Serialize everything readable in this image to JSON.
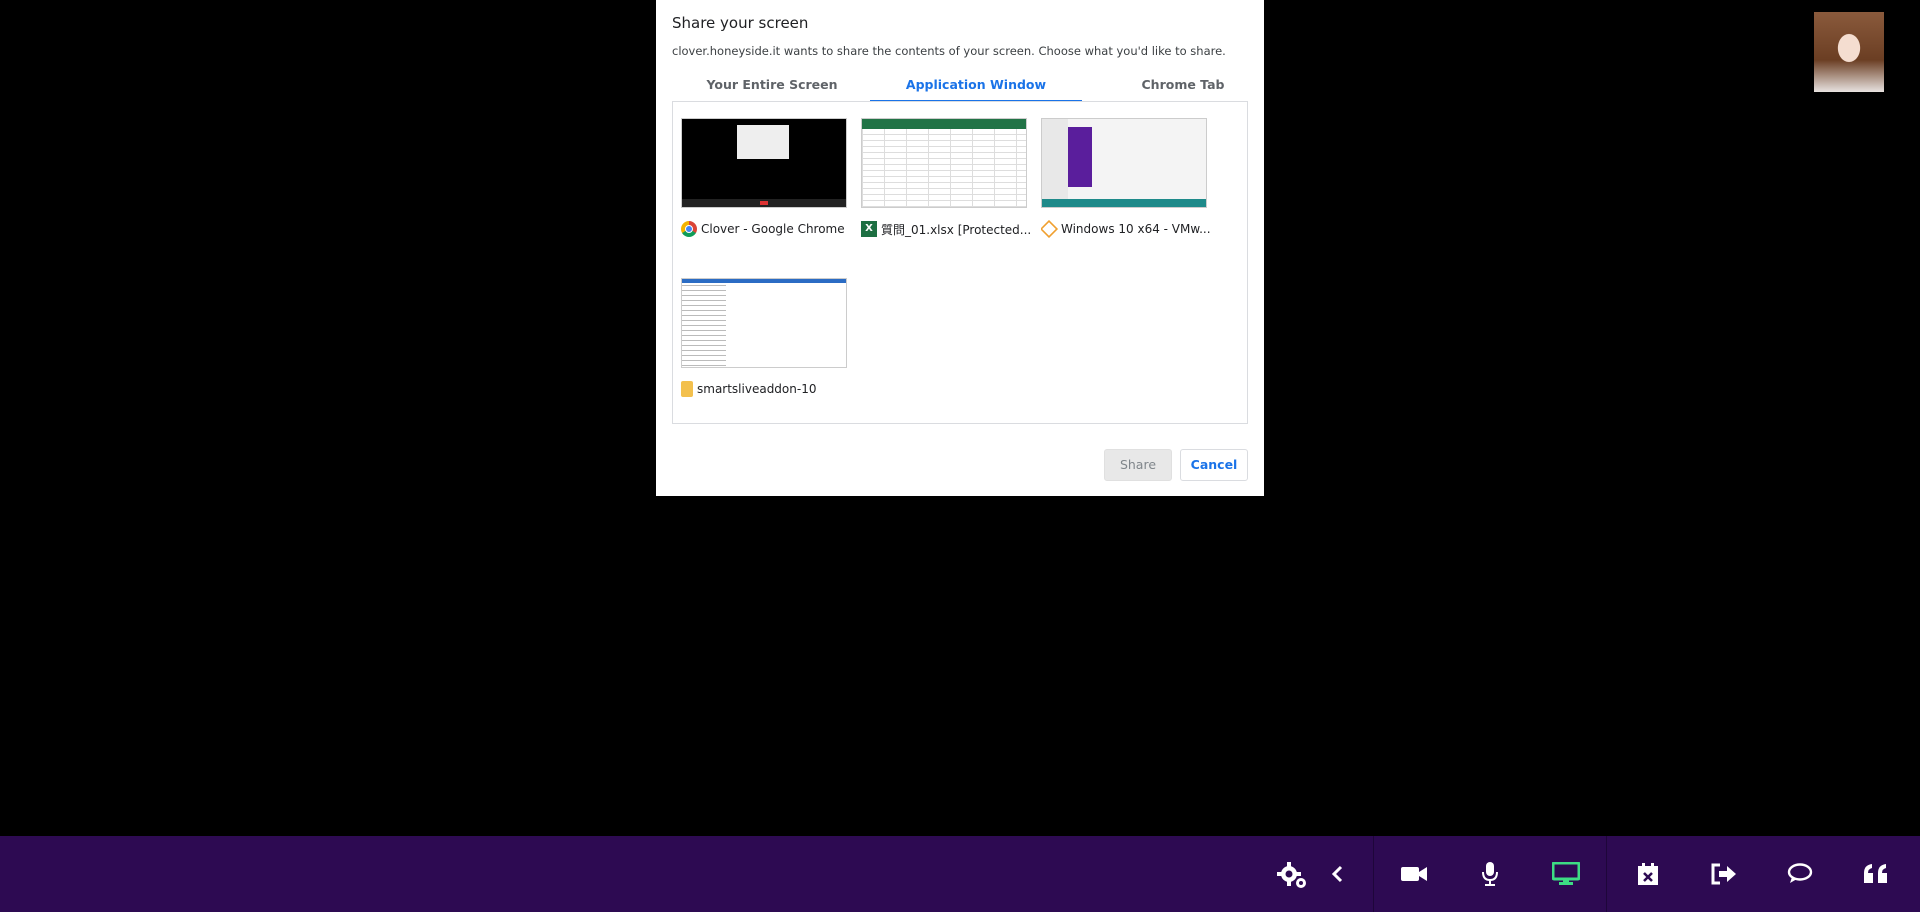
{
  "dialog": {
    "title": "Share your screen",
    "subtitle": "clover.honeyside.it wants to share the contents of your screen. Choose what you'd like to share.",
    "tabs": [
      {
        "label": "Your Entire Screen",
        "active": false
      },
      {
        "label": "Application Window",
        "active": true
      },
      {
        "label": "Chrome Tab",
        "active": false
      }
    ],
    "windows": [
      {
        "label": "Clover - Google Chrome",
        "icon": "chrome-icon"
      },
      {
        "label": "質問_01.xlsx  [Protected...",
        "icon": "excel-icon"
      },
      {
        "label": "Windows 10 x64 - VMw...",
        "icon": "vmware-icon"
      },
      {
        "label": "smartsliveaddon-10",
        "icon": "folder-icon"
      }
    ],
    "share_label": "Share",
    "cancel_label": "Cancel"
  },
  "toolbar": {
    "items": [
      "settings-icon",
      "chevron-left-icon",
      "video-camera-icon",
      "microphone-icon",
      "screen-share-icon",
      "calendar-close-icon",
      "sign-out-icon",
      "chat-icon",
      "quote-icon"
    ],
    "active_color": "#3ddc84",
    "bg_color": "#2d0a52"
  }
}
